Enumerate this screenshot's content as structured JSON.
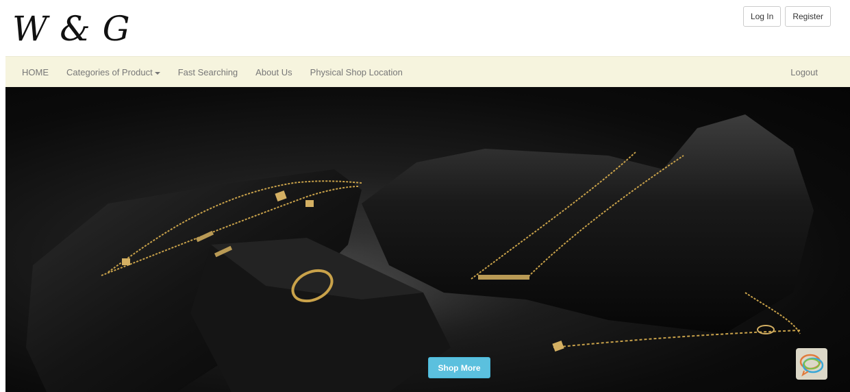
{
  "header": {
    "logo_text": "W & G",
    "login_label": "Log In",
    "register_label": "Register"
  },
  "nav": {
    "items": [
      {
        "label": "HOME"
      },
      {
        "label": "Categories of Product"
      },
      {
        "label": "Fast Searching"
      },
      {
        "label": "About Us"
      },
      {
        "label": "Physical Shop Location"
      }
    ],
    "logout_label": "Logout"
  },
  "hero": {
    "shop_button_label": "Shop More",
    "chat_icon": "chat-bubbles-icon"
  },
  "colors": {
    "navbar_bg": "#f6f4de",
    "shop_button": "#5bc0de",
    "gold": "#c9a24a"
  }
}
